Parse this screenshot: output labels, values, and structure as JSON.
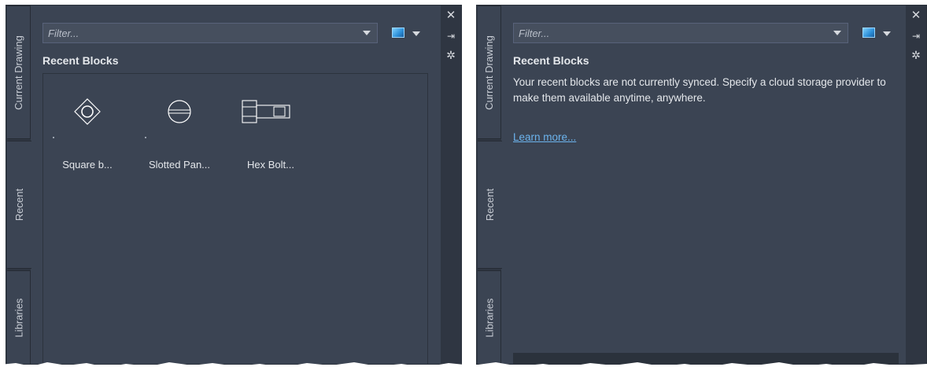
{
  "left_panel": {
    "tabs": [
      "Current Drawing",
      "Recent",
      "Libraries"
    ],
    "filter_placeholder": "Filter...",
    "section_title": "Recent Blocks",
    "blocks": [
      {
        "label": "Square b...",
        "icon": "square-bolt-icon"
      },
      {
        "label": "Slotted Pan...",
        "icon": "slotted-pan-screw-icon"
      },
      {
        "label": "Hex Bolt...",
        "icon": "hex-bolt-icon"
      }
    ],
    "side_icons": {
      "close": "✕",
      "pin": "⇥",
      "settings": "✲"
    }
  },
  "right_panel": {
    "tabs": [
      "Current Drawing",
      "Recent",
      "Libraries"
    ],
    "filter_placeholder": "Filter...",
    "section_title": "Recent Blocks",
    "message": "Your recent blocks are not currently synced. Specify a cloud storage provider to make them available anytime, anywhere.",
    "link": "Learn more...",
    "side_icons": {
      "close": "✕",
      "pin": "⇥",
      "settings": "✲"
    }
  },
  "colors": {
    "panel_bg": "#3b4453",
    "tabstrip_bg": "#2f3642",
    "text": "#e4e7eb",
    "link": "#6cb4ee"
  }
}
